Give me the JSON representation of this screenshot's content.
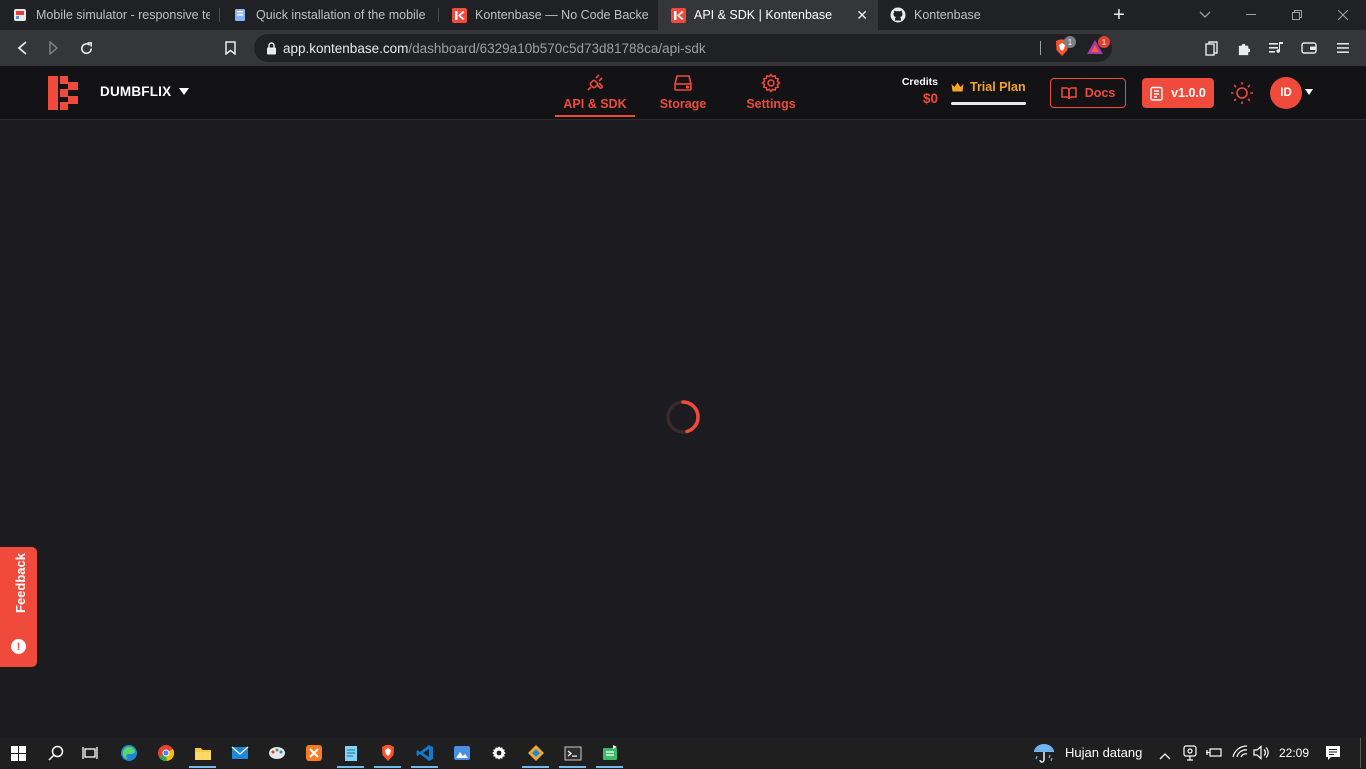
{
  "browser": {
    "tabs": [
      {
        "title": "Mobile simulator - responsive testing",
        "icon": "mobile-simulator-favicon",
        "active": false
      },
      {
        "title": "Quick installation of the mobile simulator",
        "icon": "docs-favicon",
        "active": false
      },
      {
        "title": "Kontenbase — No Code Backend API",
        "icon": "kontenbase-favicon",
        "active": false
      },
      {
        "title": "API & SDK | Kontenbase",
        "icon": "kontenbase-favicon",
        "active": true
      },
      {
        "title": "Kontenbase",
        "icon": "github-favicon",
        "active": false
      }
    ],
    "address": {
      "host": "app.kontenbase.com",
      "path": "/dashboard/6329a10b570c5d73d81788ca/api-sdk"
    },
    "shield_badge": "1",
    "rewards_badge": "1"
  },
  "app": {
    "project_name": "DUMBFLIX",
    "nav": [
      {
        "label": "API & SDK",
        "icon": "plug-icon",
        "active": true
      },
      {
        "label": "Storage",
        "icon": "storage-drive-icon",
        "active": false
      },
      {
        "label": "Settings",
        "icon": "gear-icon",
        "active": false
      }
    ],
    "credits_label": "Credits",
    "credits_value": "$0",
    "plan_label": "Trial Plan",
    "docs_label": "Docs",
    "version_label": "v1.0.0",
    "avatar_initials": "ID",
    "feedback_label": "Feedback",
    "accent_color": "#ef4a3b",
    "plan_color": "#f5a524"
  },
  "taskbar": {
    "weather_text": "Hujan datang",
    "clock": "22:09"
  }
}
